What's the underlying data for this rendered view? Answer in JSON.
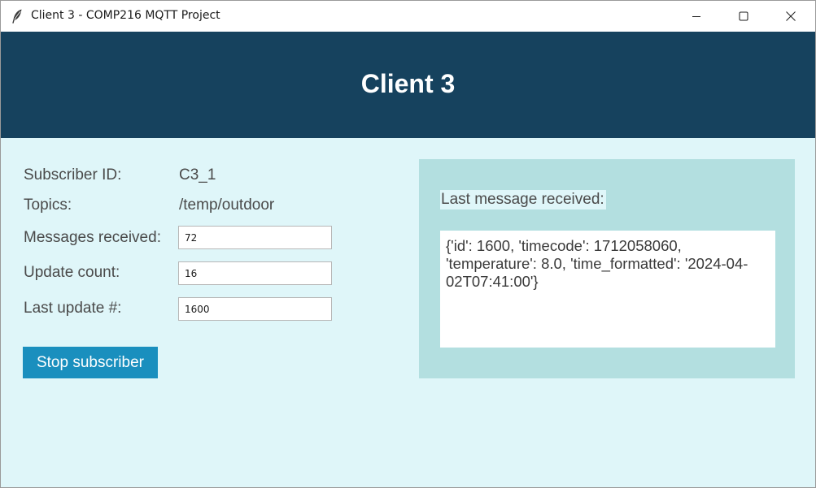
{
  "window": {
    "title": "Client 3 - COMP216 MQTT Project",
    "icon": "feather-icon",
    "controls": {
      "minimize_icon": "minimize-icon",
      "maximize_icon": "maximize-icon",
      "close_icon": "close-icon"
    }
  },
  "header": {
    "title": "Client 3",
    "background_color": "#16425e"
  },
  "info": {
    "subscriber_id_label": "Subscriber ID:",
    "subscriber_id_value": "C3_1",
    "topics_label": "Topics:",
    "topics_value": "/temp/outdoor",
    "messages_received_label": "Messages received:",
    "messages_received_value": "72",
    "update_count_label": "Update count:",
    "update_count_value": "16",
    "last_update_label": "Last update #:",
    "last_update_value": "1600"
  },
  "actions": {
    "stop_label": "Stop subscriber",
    "stop_color": "#1a8fbe"
  },
  "message_panel": {
    "title": "Last message received:",
    "content": "{'id': 1600, 'timecode': 1712058060, 'temperature': 8.0, 'time_formatted': '2024-04-02T07:41:00'}",
    "background_color": "#b3dfe0"
  },
  "colors": {
    "body_background": "#dff6f9"
  }
}
